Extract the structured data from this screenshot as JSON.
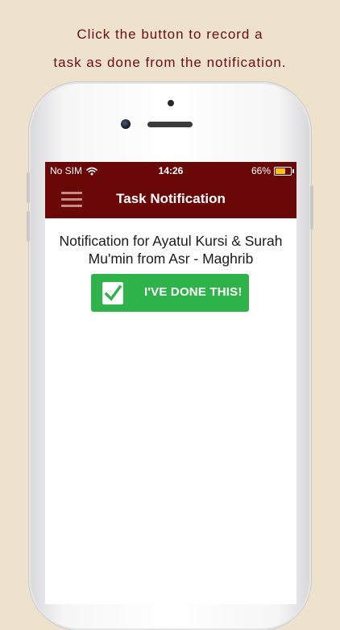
{
  "caption": {
    "line1": "Click the button to record a",
    "line2": "task as done from the notification."
  },
  "status_bar": {
    "carrier": "No SIM",
    "wifi_icon": "wifi-icon",
    "time": "14:26",
    "battery_percent": "66%",
    "battery_level": 0.66,
    "battery_color": "#f4c21f"
  },
  "nav": {
    "menu_icon": "hamburger-menu-icon",
    "title": "Task Notification",
    "bar_color": "#6a0707"
  },
  "notification": {
    "text": "Notification for Ayatul Kursi & Surah Mu'min from Asr - Maghrib"
  },
  "done_button": {
    "label": "I'VE DONE THIS!",
    "icon": "checkmark-icon",
    "color": "#2eb24a"
  }
}
